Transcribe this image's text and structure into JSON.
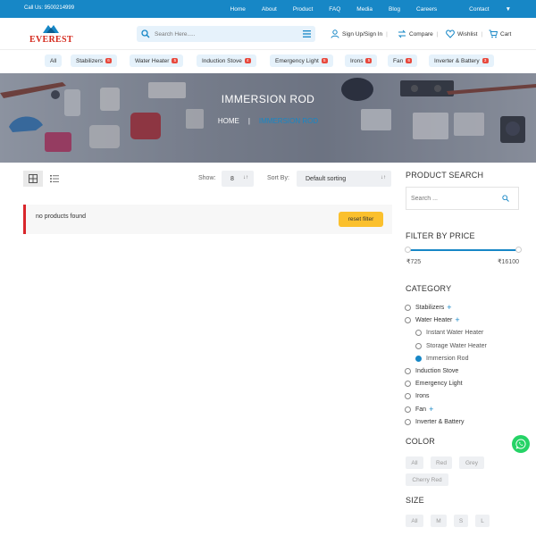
{
  "topbar": {
    "call": "Call Us: 9500214999",
    "nav": [
      "Home",
      "About",
      "Product",
      "FAQ",
      "Media",
      "Blog",
      "Careers",
      "Contact"
    ]
  },
  "header": {
    "logo_text": "EVEREST",
    "search_placeholder": "Search Here.....",
    "signin": "Sign Up/Sign In",
    "compare": "Compare",
    "wishlist": "Wishlist",
    "cart": "Cart"
  },
  "pills": [
    {
      "label": "All",
      "badge": ""
    },
    {
      "label": "Stabilizers",
      "badge": "6"
    },
    {
      "label": "Water Heater",
      "badge": "5"
    },
    {
      "label": "Induction Stove",
      "badge": "4"
    },
    {
      "label": "Emergency Light",
      "badge": "5"
    },
    {
      "label": "Irons",
      "badge": "5"
    },
    {
      "label": "Fan",
      "badge": "6"
    },
    {
      "label": "Inverter & Battery",
      "badge": "3"
    }
  ],
  "banner": {
    "title": "IMMERSION ROD",
    "crumb_home": "HOME",
    "crumb_sep": "|",
    "crumb_current": "IMMERSION ROD"
  },
  "toolbar": {
    "show_label": "Show:",
    "show_value": "8",
    "sort_label": "Sort By:",
    "sort_value": "Default sorting",
    "arrow": "↓↑"
  },
  "notice": {
    "message": "no products found",
    "reset": "reset filter"
  },
  "sidebar": {
    "search_title": "PRODUCT SEARCH",
    "search_placeholder": "Search ...",
    "filter_title": "FILTER BY PRICE",
    "price_min": "₹725",
    "price_max": "₹16100",
    "price_range_fraction": [
      0,
      1
    ],
    "category_title": "CATEGORY",
    "categories": [
      {
        "label": "Stabilizers",
        "plus": "+",
        "sub": false,
        "checked": false
      },
      {
        "label": "Water Heater",
        "plus": "+",
        "sub": false,
        "checked": false
      },
      {
        "label": "Instant Water Heater",
        "plus": "",
        "sub": true,
        "checked": false
      },
      {
        "label": "Storage Water Heater",
        "plus": "",
        "sub": true,
        "checked": false
      },
      {
        "label": "Immersion Rod",
        "plus": "",
        "sub": true,
        "checked": true
      },
      {
        "label": "Induction Stove",
        "plus": "",
        "sub": false,
        "checked": false
      },
      {
        "label": "Emergency Light",
        "plus": "",
        "sub": false,
        "checked": false
      },
      {
        "label": "Irons",
        "plus": "",
        "sub": false,
        "checked": false
      },
      {
        "label": "Fan",
        "plus": "+",
        "sub": false,
        "checked": false
      },
      {
        "label": "Inverter & Battery",
        "plus": "",
        "sub": false,
        "checked": false
      }
    ],
    "color_title": "COLOR",
    "colors": [
      "All",
      "Red",
      "Grey",
      "Cherry Red"
    ],
    "size_title": "SIZE",
    "sizes": [
      "All",
      "M",
      "S",
      "L"
    ]
  },
  "colors": {
    "brand_blue": "#1787c6",
    "accent_red": "#d9262b",
    "reset_yellow": "#fbc02d",
    "whatsapp_green": "#25d366"
  }
}
